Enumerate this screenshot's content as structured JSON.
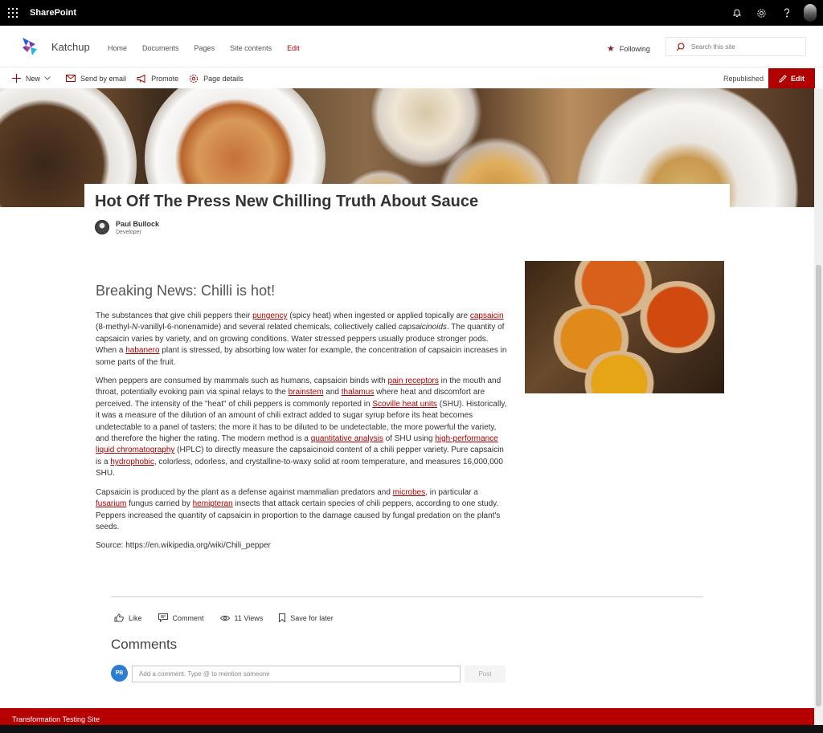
{
  "suite": {
    "brand": "SharePoint"
  },
  "site": {
    "title": "Katchup",
    "nav": [
      "Home",
      "Documents",
      "Pages",
      "Site contents",
      "Edit"
    ],
    "following_label": "Following",
    "search_placeholder": "Search this site"
  },
  "commandbar": {
    "new_label": "New",
    "send_label": "Send by email",
    "promote_label": "Promote",
    "details_label": "Page details",
    "status": "Republished",
    "edit_label": "Edit"
  },
  "page": {
    "title": "Hot Off The Press New Chilling Truth About Sauce",
    "author": "Paul Bullock",
    "author_role": "Developer"
  },
  "article": {
    "heading": "Breaking News: Chilli is hot!",
    "p1": {
      "t1": "The substances that give chili peppers their ",
      "l1": "pungency",
      "t2": " (spicy heat) when ingested or applied topically are ",
      "l2": "capsaicin",
      "t3": " (8-methyl-",
      "t3i": "N",
      "t4": "-vanillyl-6-nonenamide) and several related chemicals, collectively called ",
      "t4i": "capsaicinoids",
      "t5": ". The quantity of capsaicin varies by variety, and on growing conditions. Water stressed peppers usually produce stronger pods. When a ",
      "l3": "habanero",
      "t6": " plant is stressed, by absorbing low water for example, the concentration of capsaicin increases in some parts of the fruit."
    },
    "p2": {
      "t1": "When peppers are consumed by mammals such as humans, capsaicin binds with ",
      "l1": "pain receptors",
      "t2": " in the mouth and throat, potentially evoking pain via spinal relays to the ",
      "l2": "brainstem",
      "t3": " and ",
      "l3": "thalamus",
      "t4": " where heat and discomfort are perceived. The intensity of the \"heat\" of chili peppers is commonly reported in ",
      "l4": "Scoville heat units",
      "t5": " (SHU). Historically, it was a measure of the dilution of an amount of chili extract added to sugar syrup before its heat becomes undetectable to a panel of tasters; the more it has to be diluted to be undetectable, the more powerful the variety, and therefore the higher the rating. The modern method is a ",
      "l5": "quantitative analysis",
      "t6": " of SHU using ",
      "l6": "high-performance liquid chromatography",
      "t7": " (HPLC) to directly measure the capsaicinoid content of a chili pepper variety. Pure capsaicin is a ",
      "l7": "hydrophobic",
      "t8": ", colorless, odorless, and crystalline-to-waxy solid at room temperature, and measures 16,000,000 SHU."
    },
    "p3": {
      "t1": "Capsaicin is produced by the plant as a defense against mammalian predators and ",
      "l1": "microbes",
      "t2": ", in particular a ",
      "l2": "fusarium",
      "t3": " fungus carried by ",
      "l3": "hemipteran",
      "t4": " insects that attack certain species of chili peppers, according to one study. Peppers increased the quantity of capsaicin in proportion to the damage caused by fungal predation on the plant's seeds."
    },
    "source": "Source: https://en.wikipedia.org/wiki/Chili_pepper"
  },
  "social": {
    "like": "Like",
    "comment": "Comment",
    "views": "11 Views",
    "save": "Save for later"
  },
  "comments": {
    "heading": "Comments",
    "initials": "PB",
    "placeholder": "Add a comment. Type @ to mention someone",
    "post": "Post"
  },
  "footer": {
    "text": "Transformation Testing Site"
  },
  "colors": {
    "accent": "#a80000",
    "edit_button": "#b00000",
    "footer": "#b60000",
    "suitebar": "#000000"
  }
}
